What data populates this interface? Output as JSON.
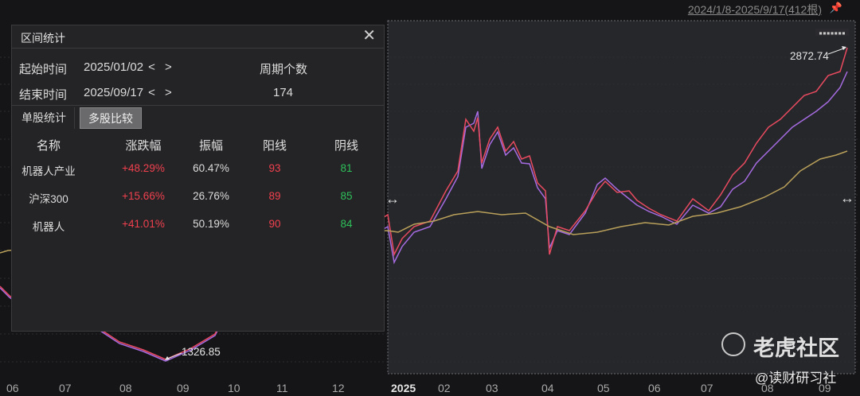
{
  "header": {
    "range_label": "2024/1/8-2025/9/17(412根)"
  },
  "colors": {
    "red": "#f0404e",
    "green": "#2ec05a",
    "series_red": "#e84a5f",
    "series_purple": "#a56be0",
    "series_gold": "#b9a05a"
  },
  "labels": {
    "high": "2872.74",
    "low": "1326.85"
  },
  "watermark": {
    "brand": "老虎社区",
    "author": "@读财研习社"
  },
  "axis_ticks": [
    "06",
    "07",
    "08",
    "09",
    "10",
    "11",
    "12",
    "2025",
    "02",
    "03",
    "04",
    "05",
    "06",
    "07",
    "08",
    "09"
  ],
  "panel": {
    "title": "区间统计",
    "start_label": "起始时间",
    "start_value": "2025/01/02",
    "end_label": "结束时间",
    "end_value": "2025/09/17",
    "arrows": "< >",
    "period_label": "周期个数",
    "period_value": "174",
    "tabs": [
      "单股统计",
      "多股比较"
    ],
    "headers": [
      "名称",
      "涨跌幅",
      "振幅",
      "阳线",
      "阴线"
    ],
    "rows": [
      {
        "name": "机器人产业",
        "change": "+48.29%",
        "amplitude": "60.47%",
        "up": "93",
        "down": "81"
      },
      {
        "name": "沪深300",
        "change": "+15.66%",
        "amplitude": "26.76%",
        "up": "89",
        "down": "85"
      },
      {
        "name": "机器人",
        "change": "+41.01%",
        "amplitude": "50.19%",
        "up": "90",
        "down": "84"
      }
    ]
  }
}
